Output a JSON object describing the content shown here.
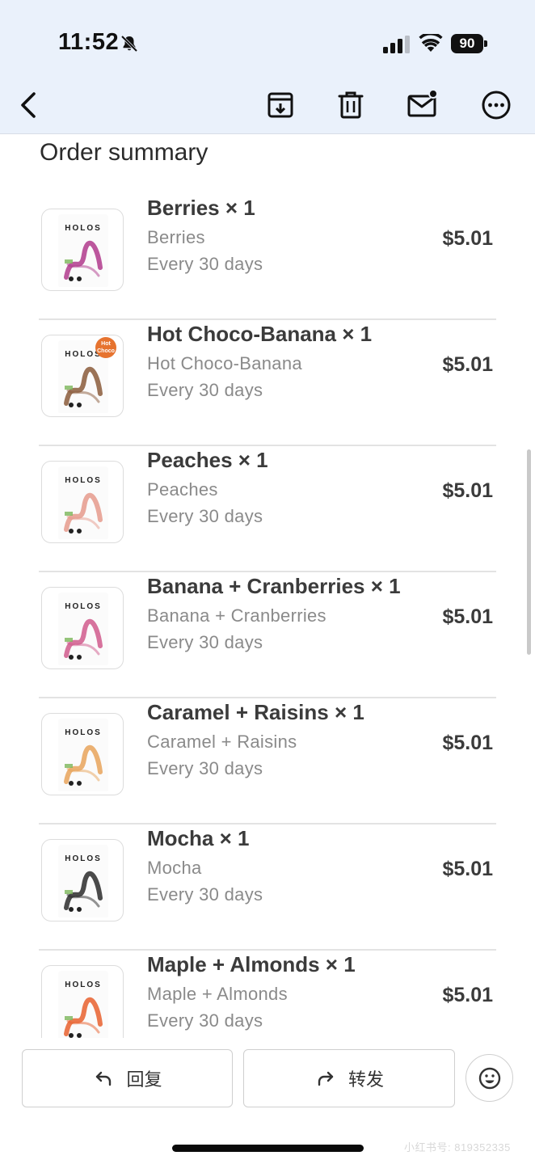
{
  "status_bar": {
    "time": "11:52",
    "battery": "90",
    "icons": [
      "bell-off-icon",
      "signal-icon",
      "wifi-icon",
      "battery-icon"
    ]
  },
  "toolbar": {
    "icons": [
      "back-icon",
      "archive-icon",
      "trash-icon",
      "mail-unread-icon",
      "more-icon"
    ]
  },
  "section_title": "Order summary",
  "items": [
    {
      "title": "Berries × 1",
      "variant": "Berries",
      "frequency": "Every 30 days",
      "price": "$5.01",
      "logo": "HOLOS",
      "accent": "#b03a8c"
    },
    {
      "title": "Hot Choco-Banana × 1",
      "variant": "Hot Choco-Banana",
      "frequency": "Every 30 days",
      "price": "$5.01",
      "logo": "HOLOS",
      "accent": "#8a5a3a"
    },
    {
      "title": "Peaches × 1",
      "variant": "Peaches",
      "frequency": "Every 30 days",
      "price": "$5.01",
      "logo": "HOLOS",
      "accent": "#e59a8c"
    },
    {
      "title": "Banana + Cranberries × 1",
      "variant": "Banana + Cranberries",
      "frequency": "Every 30 days",
      "price": "$5.01",
      "logo": "HOLOS",
      "accent": "#d05a8c"
    },
    {
      "title": "Caramel + Raisins × 1",
      "variant": "Caramel + Raisins",
      "frequency": "Every 30 days",
      "price": "$5.01",
      "logo": "HOLOS",
      "accent": "#e8a35a"
    },
    {
      "title": "Mocha × 1",
      "variant": "Mocha",
      "frequency": "Every 30 days",
      "price": "$5.01",
      "logo": "HOLOS",
      "accent": "#2a2a2a"
    },
    {
      "title": "Maple + Almonds × 1",
      "variant": "Maple + Almonds",
      "frequency": "Every 30 days",
      "price": "$5.01",
      "logo": "HOLOS",
      "accent": "#e8602e"
    }
  ],
  "actions": {
    "reply_label": "回复",
    "forward_label": "转发"
  },
  "watermark": "小红书号: 819352335",
  "colors": {
    "header_bg": "#eaf1fb",
    "text_primary": "#3b3b3b",
    "text_secondary": "#8a8a8a",
    "divider": "#e3e3e3"
  }
}
